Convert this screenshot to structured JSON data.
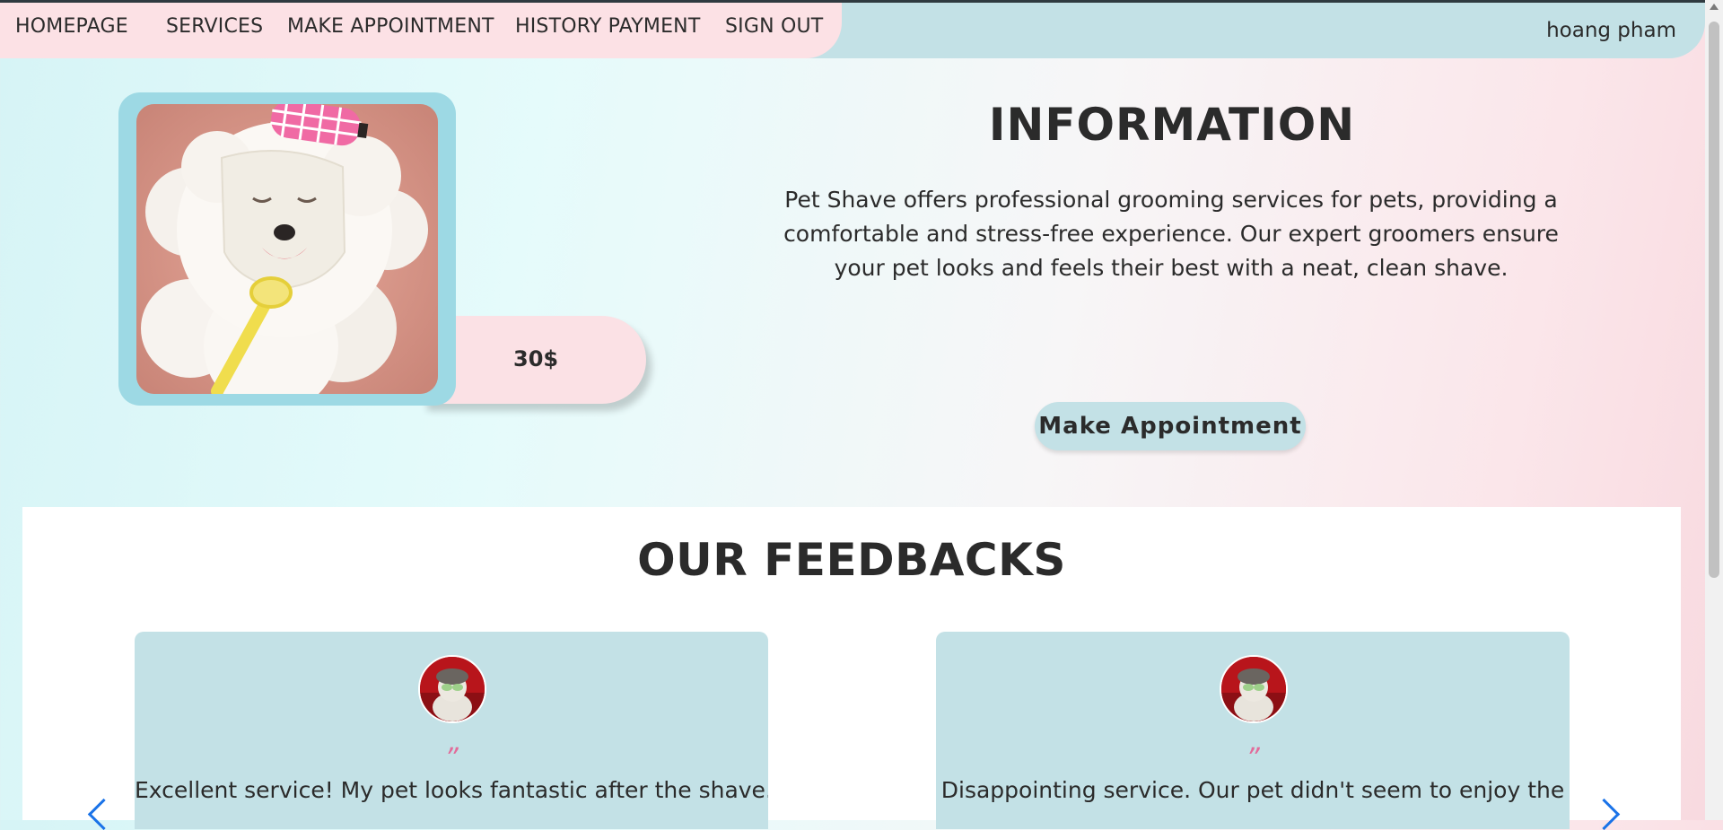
{
  "nav": {
    "items": [
      {
        "label": "HOMEPAGE"
      },
      {
        "label": "SERVICES"
      },
      {
        "label": "MAKE APPOINTMENT"
      },
      {
        "label": "HISTORY PAYMENT"
      },
      {
        "label": "SIGN OUT"
      }
    ],
    "user_name": "hoang pham"
  },
  "product": {
    "image_icon": "dog-photo",
    "price": "30$"
  },
  "info": {
    "title": "INFORMATION",
    "description": "Pet Shave offers professional grooming services for pets, providing a comfortable and stress-free experience. Our expert groomers ensure your pet looks and feels their best with a neat, clean shave.",
    "button_label": "Make Appointment"
  },
  "feedback": {
    "title": "OUR FEEDBACKS",
    "quote_mark": "”",
    "items": [
      {
        "text": "Excellent service! My pet looks fantastic after the shave."
      },
      {
        "text": "Disappointing service. Our pet didn't seem to enjoy the"
      }
    ]
  },
  "colors": {
    "nav_pink": "#fce1e5",
    "nav_blue": "#c3e1e6",
    "frame_blue": "#9dd9e4",
    "quote_pink": "#e26b9a",
    "arrow_blue": "#1a73e8"
  }
}
